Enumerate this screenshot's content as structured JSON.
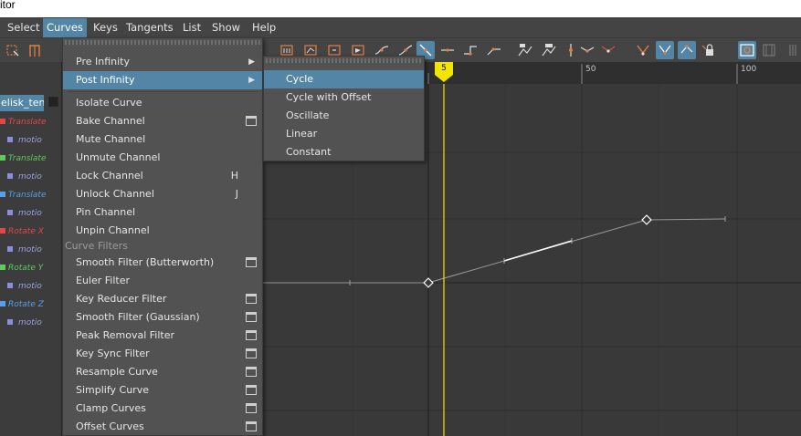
{
  "window": {
    "title": "itor"
  },
  "menubar": {
    "items": [
      {
        "label": "Select"
      },
      {
        "label": "Curves"
      },
      {
        "label": "Keys"
      },
      {
        "label": "Tangents"
      },
      {
        "label": "List"
      },
      {
        "label": "Show"
      },
      {
        "label": "Help"
      }
    ],
    "active": "Curves"
  },
  "outliner": {
    "node": "elisk_tent",
    "rows": [
      {
        "label": "Translate",
        "color": "#e04848",
        "box": "#e04848"
      },
      {
        "label": "motio",
        "color": "#9aa0e6",
        "box": "#8c8ce0"
      },
      {
        "label": "Translate",
        "color": "#5ec95e",
        "box": "#5ec95e"
      },
      {
        "label": "motio",
        "color": "#9aa0e6",
        "box": "#8c8ce0"
      },
      {
        "label": "Translate",
        "color": "#5a9ee6",
        "box": "#5a9ee6"
      },
      {
        "label": "motio",
        "color": "#9aa0e6",
        "box": "#8c8ce0"
      },
      {
        "label": "Rotate X",
        "color": "#e04848",
        "box": "#e04848"
      },
      {
        "label": "motio",
        "color": "#9aa0e6",
        "box": "#8c8ce0"
      },
      {
        "label": "Rotate Y",
        "color": "#5ec95e",
        "box": "#5ec95e"
      },
      {
        "label": "motio",
        "color": "#9aa0e6",
        "box": "#8c8ce0"
      },
      {
        "label": "Rotate Z",
        "color": "#5a9ee6",
        "box": "#5a9ee6"
      },
      {
        "label": "motio",
        "color": "#9aa0e6",
        "box": "#8c8ce0"
      }
    ]
  },
  "timeline": {
    "current_frame": "5",
    "labels": [
      "50",
      "100"
    ]
  },
  "curves_menu": {
    "items": [
      {
        "label": "Pre Infinity",
        "submenu": true
      },
      {
        "label": "Post Infinity",
        "submenu": true
      },
      {
        "label": "Isolate Curve"
      },
      {
        "label": "Bake Channel",
        "option_box": true
      },
      {
        "label": "Mute Channel"
      },
      {
        "label": "Unmute Channel"
      },
      {
        "label": "Lock Channel",
        "hotkey": "H"
      },
      {
        "label": "Unlock Channel",
        "hotkey": "J"
      },
      {
        "label": "Pin Channel"
      },
      {
        "label": "Unpin Channel"
      }
    ],
    "section_label": "Curve Filters",
    "filters": [
      {
        "label": "Smooth Filter (Butterworth)",
        "option_box": true
      },
      {
        "label": "Euler Filter"
      },
      {
        "label": "Key Reducer Filter",
        "option_box": true
      },
      {
        "label": "Smooth Filter (Gaussian)",
        "option_box": true
      },
      {
        "label": "Peak Removal Filter",
        "option_box": true
      },
      {
        "label": "Key Sync Filter",
        "option_box": true
      },
      {
        "label": "Resample Curve",
        "option_box": true
      },
      {
        "label": "Simplify Curve",
        "option_box": true
      },
      {
        "label": "Clamp Curves",
        "option_box": true
      },
      {
        "label": "Offset Curves",
        "option_box": true
      }
    ],
    "highlighted": "Post Infinity"
  },
  "post_infinity_submenu": {
    "items": [
      {
        "label": "Cycle"
      },
      {
        "label": "Cycle with Offset"
      },
      {
        "label": "Oscillate"
      },
      {
        "label": "Linear"
      },
      {
        "label": "Constant"
      }
    ],
    "highlighted": "Cycle"
  },
  "colors": {
    "accent": "#5285a6",
    "time_cursor": "#f2e600",
    "curve": "#9a9a9a",
    "selected_segment": "#ffffff"
  }
}
